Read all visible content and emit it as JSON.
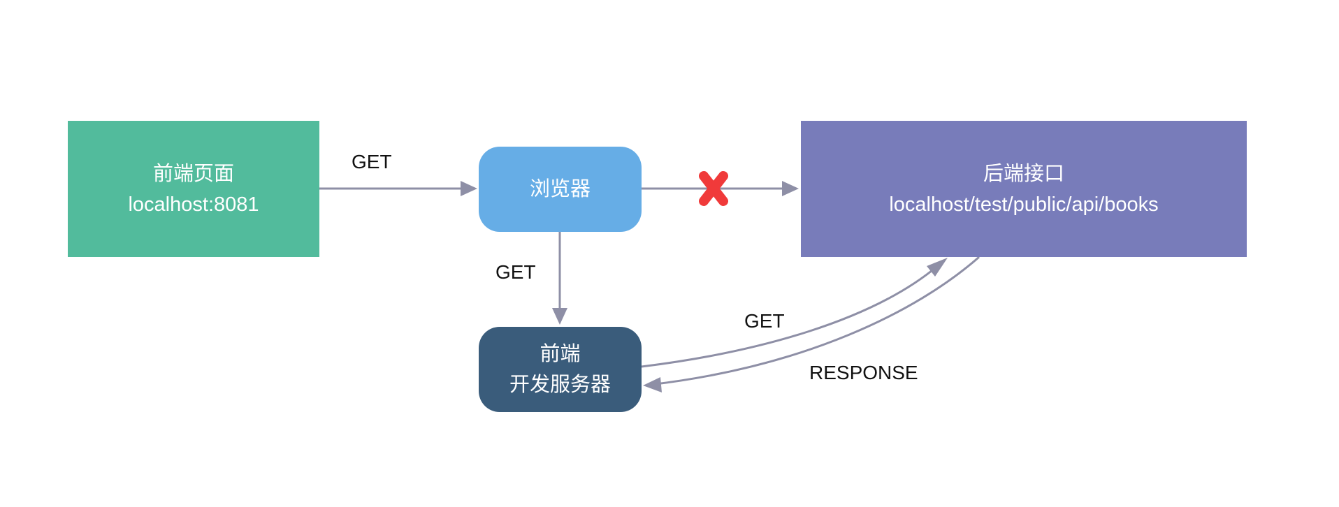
{
  "colors": {
    "frontend_page": "#52bb9c",
    "browser": "#66ade6",
    "backend_api": "#787cba",
    "dev_server": "#3a5c7b",
    "edge": "#8e8fa6",
    "blocked_mark": "#f03a3a"
  },
  "nodes": {
    "frontend_page": {
      "line1": "前端页面",
      "line2": "localhost:8081"
    },
    "browser": {
      "line1": "浏览器"
    },
    "backend_api": {
      "line1": "后端接口",
      "line2": "localhost/test/public/api/books"
    },
    "dev_server": {
      "line1": "前端",
      "line2": "开发服务器"
    }
  },
  "edges": {
    "page_to_browser": {
      "label": "GET"
    },
    "browser_to_devserver": {
      "label": "GET"
    },
    "devserver_to_api": {
      "label": "GET"
    },
    "api_to_devserver": {
      "label": "RESPONSE"
    },
    "browser_to_api": {
      "blocked": true,
      "icon": "cross-icon"
    }
  }
}
